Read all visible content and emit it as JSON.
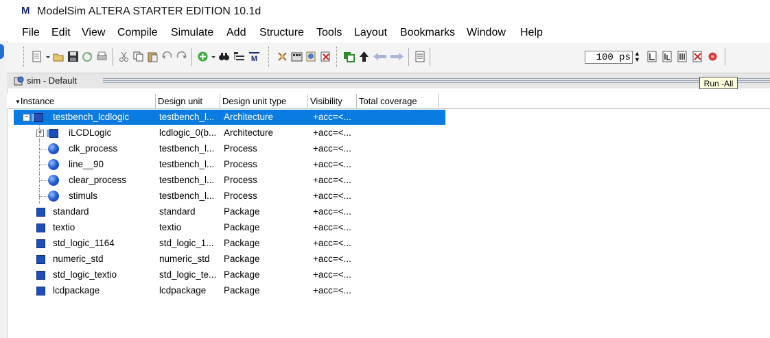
{
  "app": {
    "title": "ModelSim ALTERA STARTER EDITION 10.1d",
    "logo_letter": "M"
  },
  "menu": [
    "File",
    "Edit",
    "View",
    "Compile",
    "Simulate",
    "Add",
    "Structure",
    "Tools",
    "Layout",
    "Bookmarks",
    "Window",
    "Help"
  ],
  "toolbar": {
    "time_value": "100 ps",
    "tooltip": "Run -All",
    "icons": [
      "new-file-icon",
      "open-folder-icon",
      "save-icon",
      "reload-icon",
      "print-icon",
      "cut-icon",
      "copy-icon",
      "paste-icon",
      "undo-icon",
      "redo-icon",
      "add-icon",
      "find-icon",
      "toggle-structure-icon",
      "modelsim-icon",
      "compile-icon",
      "compile-all-icon",
      "simulate-icon",
      "break-icon",
      "restart-icon",
      "up-arrow-icon",
      "back-icon",
      "forward-icon",
      "run-length-icon",
      "run-icon",
      "continue-icon",
      "run-all-icon",
      "break-stop-icon",
      "stop-icon"
    ]
  },
  "panel": {
    "title": "sim - Default"
  },
  "columns": [
    "Instance",
    "Design unit",
    "Design unit type",
    "Visibility",
    "Total coverage"
  ],
  "rows": [
    {
      "instance": "testbench_lcdlogic",
      "unit": "testbench_l...",
      "type": "Architecture",
      "visibility": "+acc=<...",
      "icon": "architecture-icon",
      "level": 0,
      "expander": "-",
      "selected": true
    },
    {
      "instance": "iLCDLogic",
      "unit": "lcdlogic_0(b...",
      "type": "Architecture",
      "visibility": "+acc=<...",
      "icon": "architecture-icon",
      "level": 1,
      "expander": "+",
      "selected": false
    },
    {
      "instance": "clk_process",
      "unit": "testbench_l...",
      "type": "Process",
      "visibility": "+acc=<...",
      "icon": "process-icon",
      "level": 1,
      "expander": "",
      "selected": false
    },
    {
      "instance": "line__90",
      "unit": "testbench_l...",
      "type": "Process",
      "visibility": "+acc=<...",
      "icon": "process-icon",
      "level": 1,
      "expander": "",
      "selected": false
    },
    {
      "instance": "clear_process",
      "unit": "testbench_l...",
      "type": "Process",
      "visibility": "+acc=<...",
      "icon": "process-icon",
      "level": 1,
      "expander": "",
      "selected": false
    },
    {
      "instance": "stimuls",
      "unit": "testbench_l...",
      "type": "Process",
      "visibility": "+acc=<...",
      "icon": "process-icon",
      "level": 1,
      "expander": "",
      "selected": false
    },
    {
      "instance": "standard",
      "unit": "standard",
      "type": "Package",
      "visibility": "+acc=<...",
      "icon": "package-icon",
      "level": 0,
      "expander": "",
      "selected": false
    },
    {
      "instance": "textio",
      "unit": "textio",
      "type": "Package",
      "visibility": "+acc=<...",
      "icon": "package-icon",
      "level": 0,
      "expander": "",
      "selected": false
    },
    {
      "instance": "std_logic_1164",
      "unit": "std_logic_1...",
      "type": "Package",
      "visibility": "+acc=<...",
      "icon": "package-icon",
      "level": 0,
      "expander": "",
      "selected": false
    },
    {
      "instance": "numeric_std",
      "unit": "numeric_std",
      "type": "Package",
      "visibility": "+acc=<...",
      "icon": "package-icon",
      "level": 0,
      "expander": "",
      "selected": false
    },
    {
      "instance": "std_logic_textio",
      "unit": "std_logic_te...",
      "type": "Package",
      "visibility": "+acc=<...",
      "icon": "package-icon",
      "level": 0,
      "expander": "",
      "selected": false
    },
    {
      "instance": "lcdpackage",
      "unit": "lcdpackage",
      "type": "Package",
      "visibility": "+acc=<...",
      "icon": "package-icon",
      "level": 0,
      "expander": "",
      "selected": false
    }
  ],
  "colors": {
    "selection": "#0a7be0",
    "icon_blue": "#1e4fb8"
  }
}
